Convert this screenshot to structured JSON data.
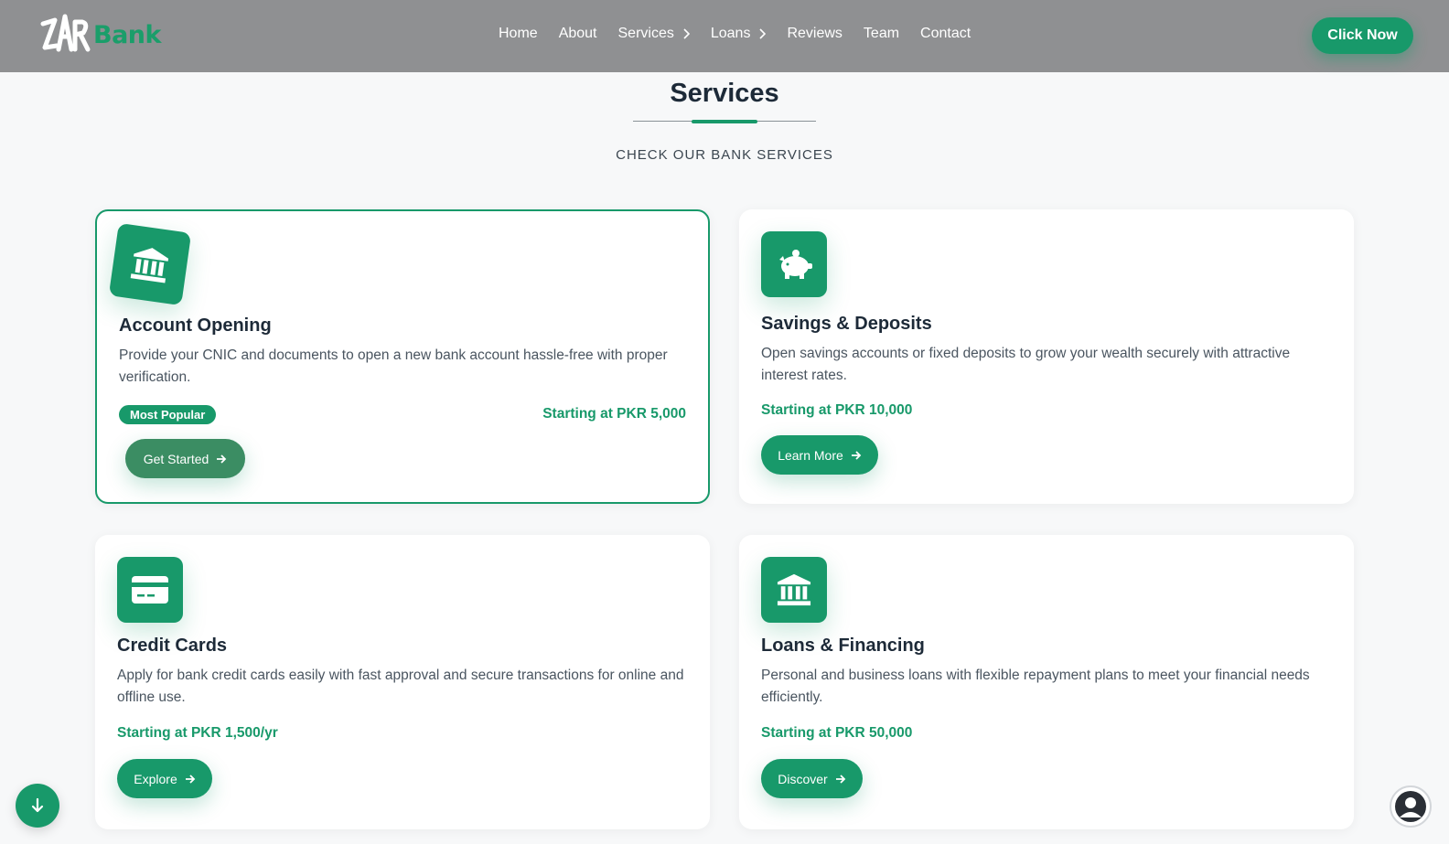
{
  "header": {
    "logo_text": "Bank",
    "logo_mark_letters": "ZAR",
    "nav": [
      {
        "label": "Home",
        "has_chevron": false
      },
      {
        "label": "About",
        "has_chevron": false
      },
      {
        "label": "Services",
        "has_chevron": true
      },
      {
        "label": "Loans",
        "has_chevron": true
      },
      {
        "label": "Reviews",
        "has_chevron": false
      },
      {
        "label": "Team",
        "has_chevron": false
      },
      {
        "label": "Contact",
        "has_chevron": false
      }
    ],
    "cta_label": "Click Now"
  },
  "section": {
    "title": "Services",
    "subtitle": "CHECK OUR BANK SERVICES"
  },
  "cards": [
    {
      "title": "Account Opening",
      "description": "Provide your CNIC and documents to open a new bank account hassle-free with proper verification.",
      "badge": "Most Popular",
      "price": "Starting at PKR 5,000",
      "button": "Get Started",
      "icon": "bank-building-icon",
      "featured": true
    },
    {
      "title": "Savings & Deposits",
      "description": "Open savings accounts or fixed deposits to grow your wealth securely with attractive interest rates.",
      "price": "Starting at PKR 10,000",
      "button": "Learn More",
      "icon": "piggy-bank-icon"
    },
    {
      "title": "Credit Cards",
      "description": "Apply for bank credit cards easily with fast approval and secure transactions for online and offline use.",
      "price": "Starting at PKR 1,500/yr",
      "button": "Explore",
      "icon": "credit-card-icon"
    },
    {
      "title": "Loans & Financing",
      "description": "Personal and business loans with flexible repayment plans to meet your financial needs efficiently.",
      "price": "Starting at PKR 50,000",
      "button": "Discover",
      "icon": "bank-building-icon"
    }
  ],
  "colors": {
    "accent": "#18996a",
    "header_bg": "#8f9092",
    "page_bg": "#f7f8f9"
  },
  "floating": {
    "scroll_down_icon": "arrow-down-icon",
    "chat_icon": "user-avatar-icon"
  }
}
